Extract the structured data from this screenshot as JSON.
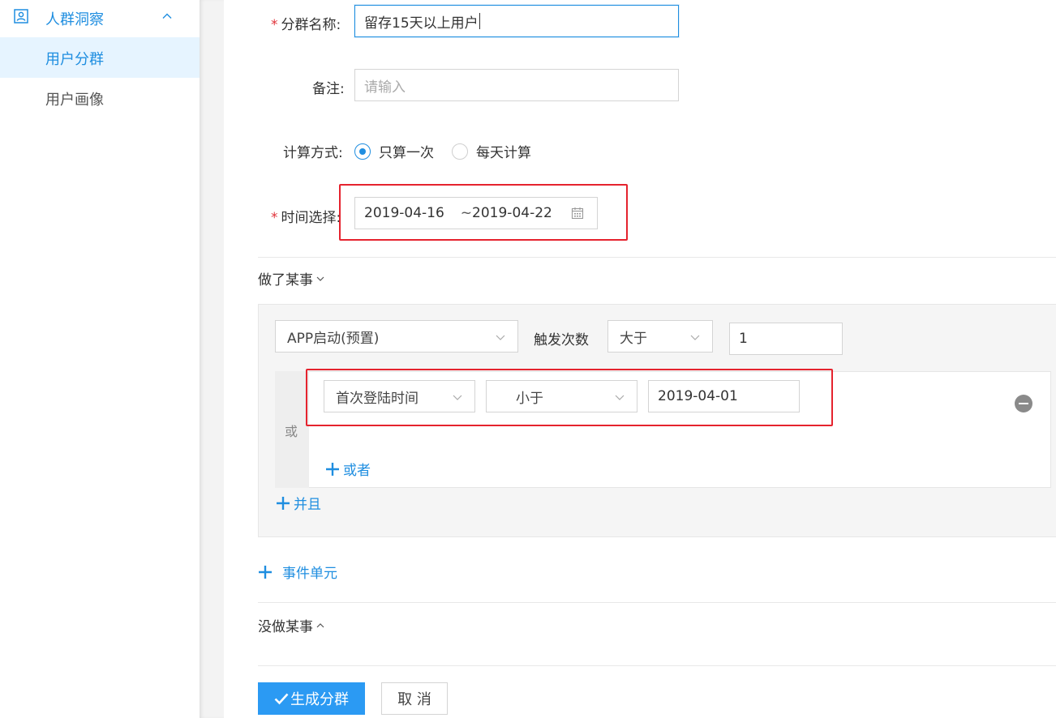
{
  "sidebar": {
    "group": {
      "label": "人群洞察",
      "icon": "user-card-icon",
      "expanded": true
    },
    "items": [
      {
        "label": "用户分群",
        "active": true
      },
      {
        "label": "用户画像",
        "active": false
      }
    ]
  },
  "form": {
    "name": {
      "label": "分群名称:",
      "value": "留存15天以上用户",
      "required": true
    },
    "remark": {
      "label": "备注:",
      "placeholder": "请输入"
    },
    "calc": {
      "label": "计算方式:",
      "options": [
        {
          "label": "只算一次",
          "checked": true
        },
        {
          "label": "每天计算",
          "checked": false
        }
      ]
    },
    "time": {
      "label": "时间选择:",
      "start": "2019-04-16",
      "separator": "~",
      "end": "2019-04-22",
      "required": true
    }
  },
  "did": {
    "title": "做了某事",
    "event_select": "APP启动(预置)",
    "trigger_label": "触发次数",
    "compare_select": "大于",
    "count_value": "1",
    "or_label": "或",
    "condition": {
      "field": "首次登陆时间",
      "operator": "小于",
      "value": "2019-04-01"
    },
    "or_link": "或者",
    "and_link": "并且",
    "add_event_link": "事件单元"
  },
  "not_did": {
    "title": "没做某事"
  },
  "actions": {
    "submit": "生成分群",
    "cancel": "取 消"
  },
  "colors": {
    "accent": "#1f8ee0",
    "primary_button": "#2b9af3",
    "highlight": "#e5232e",
    "required": "#e0333a"
  }
}
